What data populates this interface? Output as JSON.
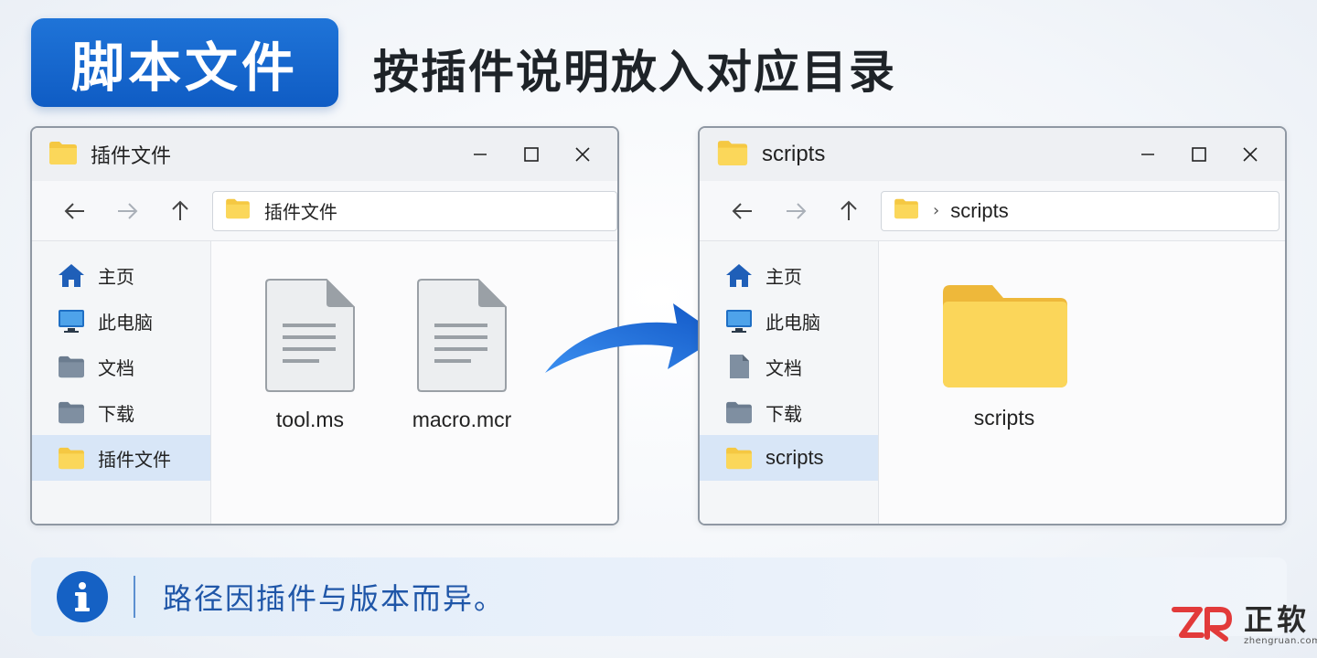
{
  "header": {
    "badge_title": "脚本文件",
    "subtitle": "按插件说明放入对应目录"
  },
  "left_window": {
    "title": "插件文件",
    "address": "插件文件",
    "sidebar": [
      {
        "label": "主页",
        "icon": "home-icon"
      },
      {
        "label": "此电脑",
        "icon": "monitor-icon"
      },
      {
        "label": "文档",
        "icon": "folder-icon"
      },
      {
        "label": "下载",
        "icon": "folder-icon"
      },
      {
        "label": "插件文件",
        "icon": "folder-icon",
        "selected": true
      }
    ],
    "files": [
      {
        "name": "tool.ms",
        "icon": "document-icon"
      },
      {
        "name": "macro.mcr",
        "icon": "document-icon"
      }
    ]
  },
  "right_window": {
    "title": "scripts",
    "address_chevron": "›",
    "address": "scripts",
    "sidebar": [
      {
        "label": "主页",
        "icon": "home-icon"
      },
      {
        "label": "此电脑",
        "icon": "monitor-icon"
      },
      {
        "label": "文档",
        "icon": "document-icon"
      },
      {
        "label": "下载",
        "icon": "folder-icon"
      },
      {
        "label": "scripts",
        "icon": "folder-icon",
        "selected": true
      }
    ],
    "files": [
      {
        "name": "scripts",
        "icon": "folder-icon"
      }
    ]
  },
  "info": {
    "text": "路径因插件与版本而异。"
  },
  "brand": {
    "name": "正软",
    "domain": "zhengruan.com"
  },
  "colors": {
    "accent": "#1561c4",
    "folder": "#f5c842",
    "selected_bg": "#d8e6f7"
  }
}
